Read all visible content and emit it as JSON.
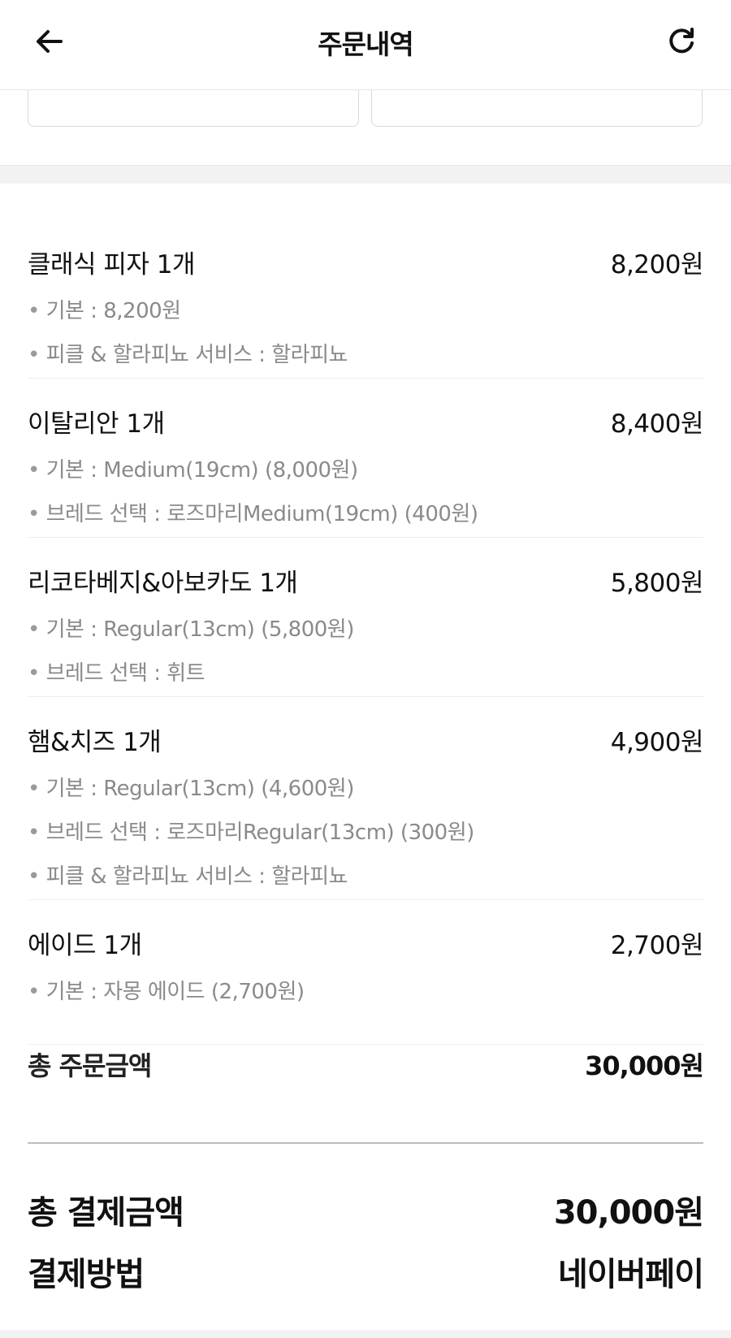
{
  "header": {
    "title": "주문내역",
    "back_icon": "arrow-left-icon",
    "refresh_icon": "refresh-icon"
  },
  "orders": [
    {
      "name": "클래식 피자 1개",
      "price": "8,200원",
      "options": [
        "기본 : 8,200원",
        "피클 & 할라피뇨 서비스 : 할라피뇨"
      ]
    },
    {
      "name": "이탈리안 1개",
      "price": "8,400원",
      "options": [
        "기본 : Medium(19cm) (8,000원)",
        "브레드 선택 : 로즈마리Medium(19cm) (400원)"
      ]
    },
    {
      "name": "리코타베지&아보카도 1개",
      "price": "5,800원",
      "options": [
        "기본 : Regular(13cm) (5,800원)",
        "브레드 선택 : 휘트"
      ]
    },
    {
      "name": "햄&치즈 1개",
      "price": "4,900원",
      "options": [
        "기본 : Regular(13cm) (4,600원)",
        "브레드 선택 : 로즈마리Regular(13cm) (300원)",
        "피클 & 할라피뇨 서비스 : 할라피뇨"
      ]
    },
    {
      "name": "에이드 1개",
      "price": "2,700원",
      "options": [
        "기본 : 자몽 에이드 (2,700원)"
      ]
    }
  ],
  "summary": {
    "total_order_label": "총 주문금액",
    "total_order_value": "30,000원",
    "total_payment_label": "총 결제금액",
    "total_payment_value": "30,000원",
    "payment_method_label": "결제방법",
    "payment_method_value": "네이버페이"
  }
}
